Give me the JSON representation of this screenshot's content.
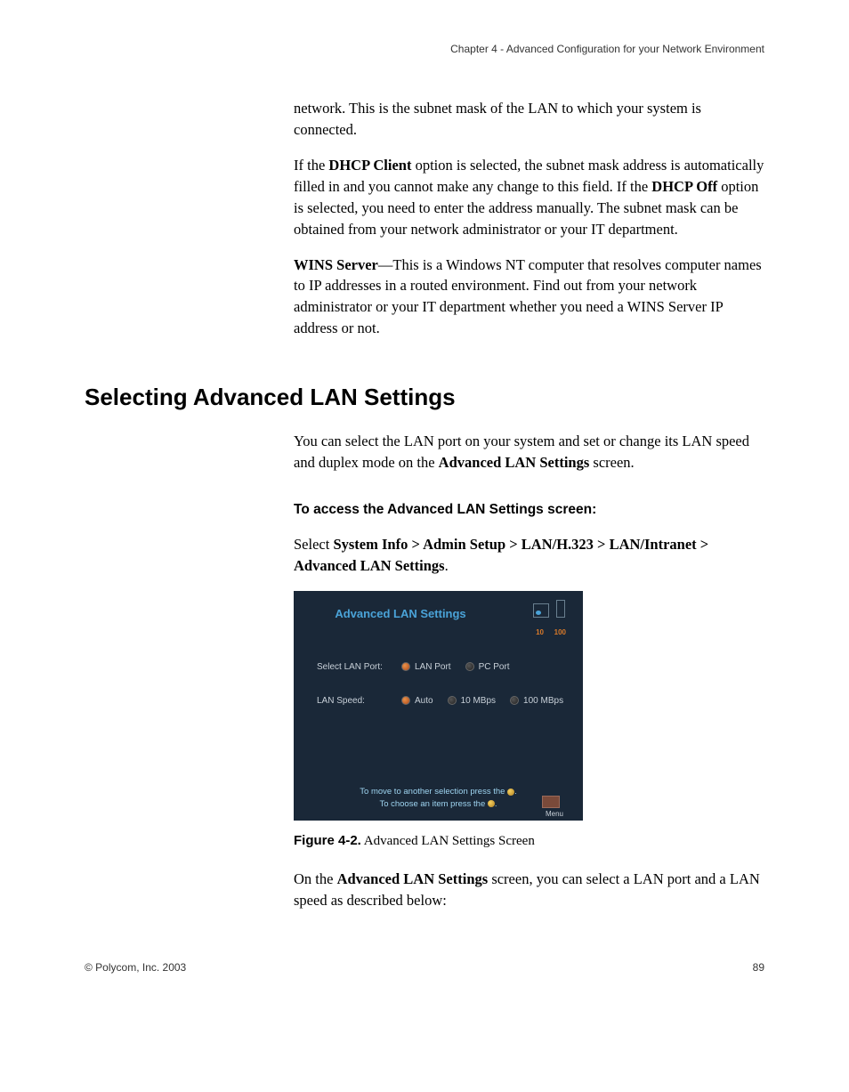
{
  "chapter_header": "Chapter 4 - Advanced Configuration for your Network Environment",
  "para1": "network. This is the subnet mask of the LAN to which your system is connected.",
  "para2_prefix": "If the ",
  "para2_bold1": "DHCP Client",
  "para2_mid": " option is selected, the subnet mask address is automatically filled in and you cannot make any change to this field. If the ",
  "para2_bold2": "DHCP Off",
  "para2_suffix": " option is selected, you need to enter the address manually. The subnet mask can be obtained from your network administrator or your IT department.",
  "para3_bold": "WINS Server",
  "para3_rest": "—This is a Windows NT computer that resolves computer names to IP addresses in a routed environment. Find out from your network administrator or your IT department whether you need a WINS Server IP address or not.",
  "heading": "Selecting Advanced LAN Settings",
  "para4_prefix": "You can select the LAN port on your system and set or change its LAN speed and duplex mode on the ",
  "para4_bold": "Advanced LAN Settings",
  "para4_suffix": " screen.",
  "access_heading": "To access the Advanced LAN Settings screen:",
  "para5_prefix": "Select ",
  "para5_bold": "System Info > Admin Setup > LAN/H.323 > LAN/Intranet > Advanced LAN Settings",
  "para5_suffix": ".",
  "screenshot": {
    "title": "Advanced LAN Settings",
    "label10": "10",
    "label100": "100",
    "row1_label": "Select LAN Port:",
    "row1_opt1": "LAN Port",
    "row1_opt2": "PC Port",
    "row2_label": "LAN Speed:",
    "row2_opt1": "Auto",
    "row2_opt2": "10 MBps",
    "row2_opt3": "100 MBps",
    "footer_line1": "To move to another selection press the ",
    "footer_line2": "To choose an item press the ",
    "menu": "Menu"
  },
  "figure_caption_bold": "Figure 4-2.",
  "figure_caption_rest": "  Advanced LAN Settings Screen",
  "para6_prefix": "On the ",
  "para6_bold": "Advanced LAN Settings",
  "para6_suffix": " screen, you can select a LAN port and a LAN speed as described below:",
  "footer_left": "© Polycom, Inc. 2003",
  "footer_right": "89"
}
